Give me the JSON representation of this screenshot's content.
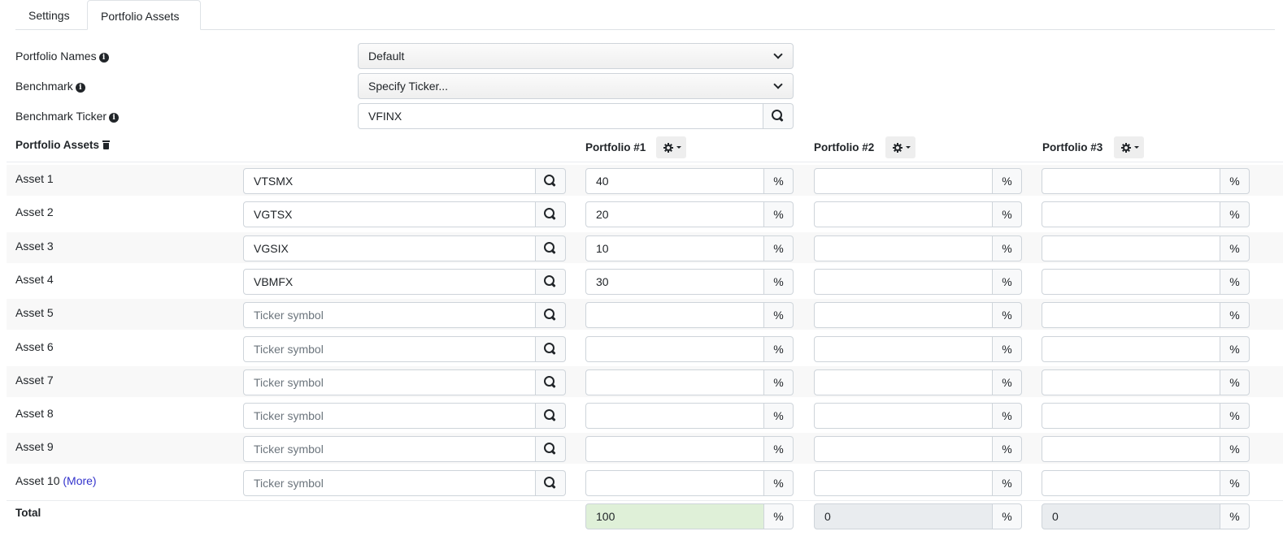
{
  "tabs": [
    {
      "label": "Settings",
      "active": false
    },
    {
      "label": "Portfolio Assets",
      "active": true
    }
  ],
  "form": {
    "portfolio_names": {
      "label": "Portfolio Names",
      "value": "Default"
    },
    "benchmark": {
      "label": "Benchmark",
      "value": "Specify Ticker..."
    },
    "benchmark_ticker": {
      "label": "Benchmark Ticker",
      "value": "VFINX"
    }
  },
  "assets_header": {
    "label": "Portfolio Assets",
    "portfolios": [
      "Portfolio #1",
      "Portfolio #2",
      "Portfolio #3"
    ]
  },
  "ticker_placeholder": "Ticker symbol",
  "percent_sign": "%",
  "assets": [
    {
      "label": "Asset 1",
      "ticker": "VTSMX",
      "alloc": [
        "40",
        "",
        ""
      ]
    },
    {
      "label": "Asset 2",
      "ticker": "VGTSX",
      "alloc": [
        "20",
        "",
        ""
      ]
    },
    {
      "label": "Asset 3",
      "ticker": "VGSIX",
      "alloc": [
        "10",
        "",
        ""
      ]
    },
    {
      "label": "Asset 4",
      "ticker": "VBMFX",
      "alloc": [
        "30",
        "",
        ""
      ]
    },
    {
      "label": "Asset 5",
      "ticker": "",
      "alloc": [
        "",
        "",
        ""
      ]
    },
    {
      "label": "Asset 6",
      "ticker": "",
      "alloc": [
        "",
        "",
        ""
      ]
    },
    {
      "label": "Asset 7",
      "ticker": "",
      "alloc": [
        "",
        "",
        ""
      ]
    },
    {
      "label": "Asset 8",
      "ticker": "",
      "alloc": [
        "",
        "",
        ""
      ]
    },
    {
      "label": "Asset 9",
      "ticker": "",
      "alloc": [
        "",
        "",
        ""
      ]
    },
    {
      "label": "Asset 10",
      "more": "(More)",
      "ticker": "",
      "alloc": [
        "",
        "",
        ""
      ]
    }
  ],
  "total": {
    "label": "Total",
    "values": [
      "100",
      "0",
      "0"
    ]
  },
  "colors": {
    "total_ok": "#dff0d8",
    "total_zero": "#e9ecef",
    "link": "#3333cc"
  }
}
